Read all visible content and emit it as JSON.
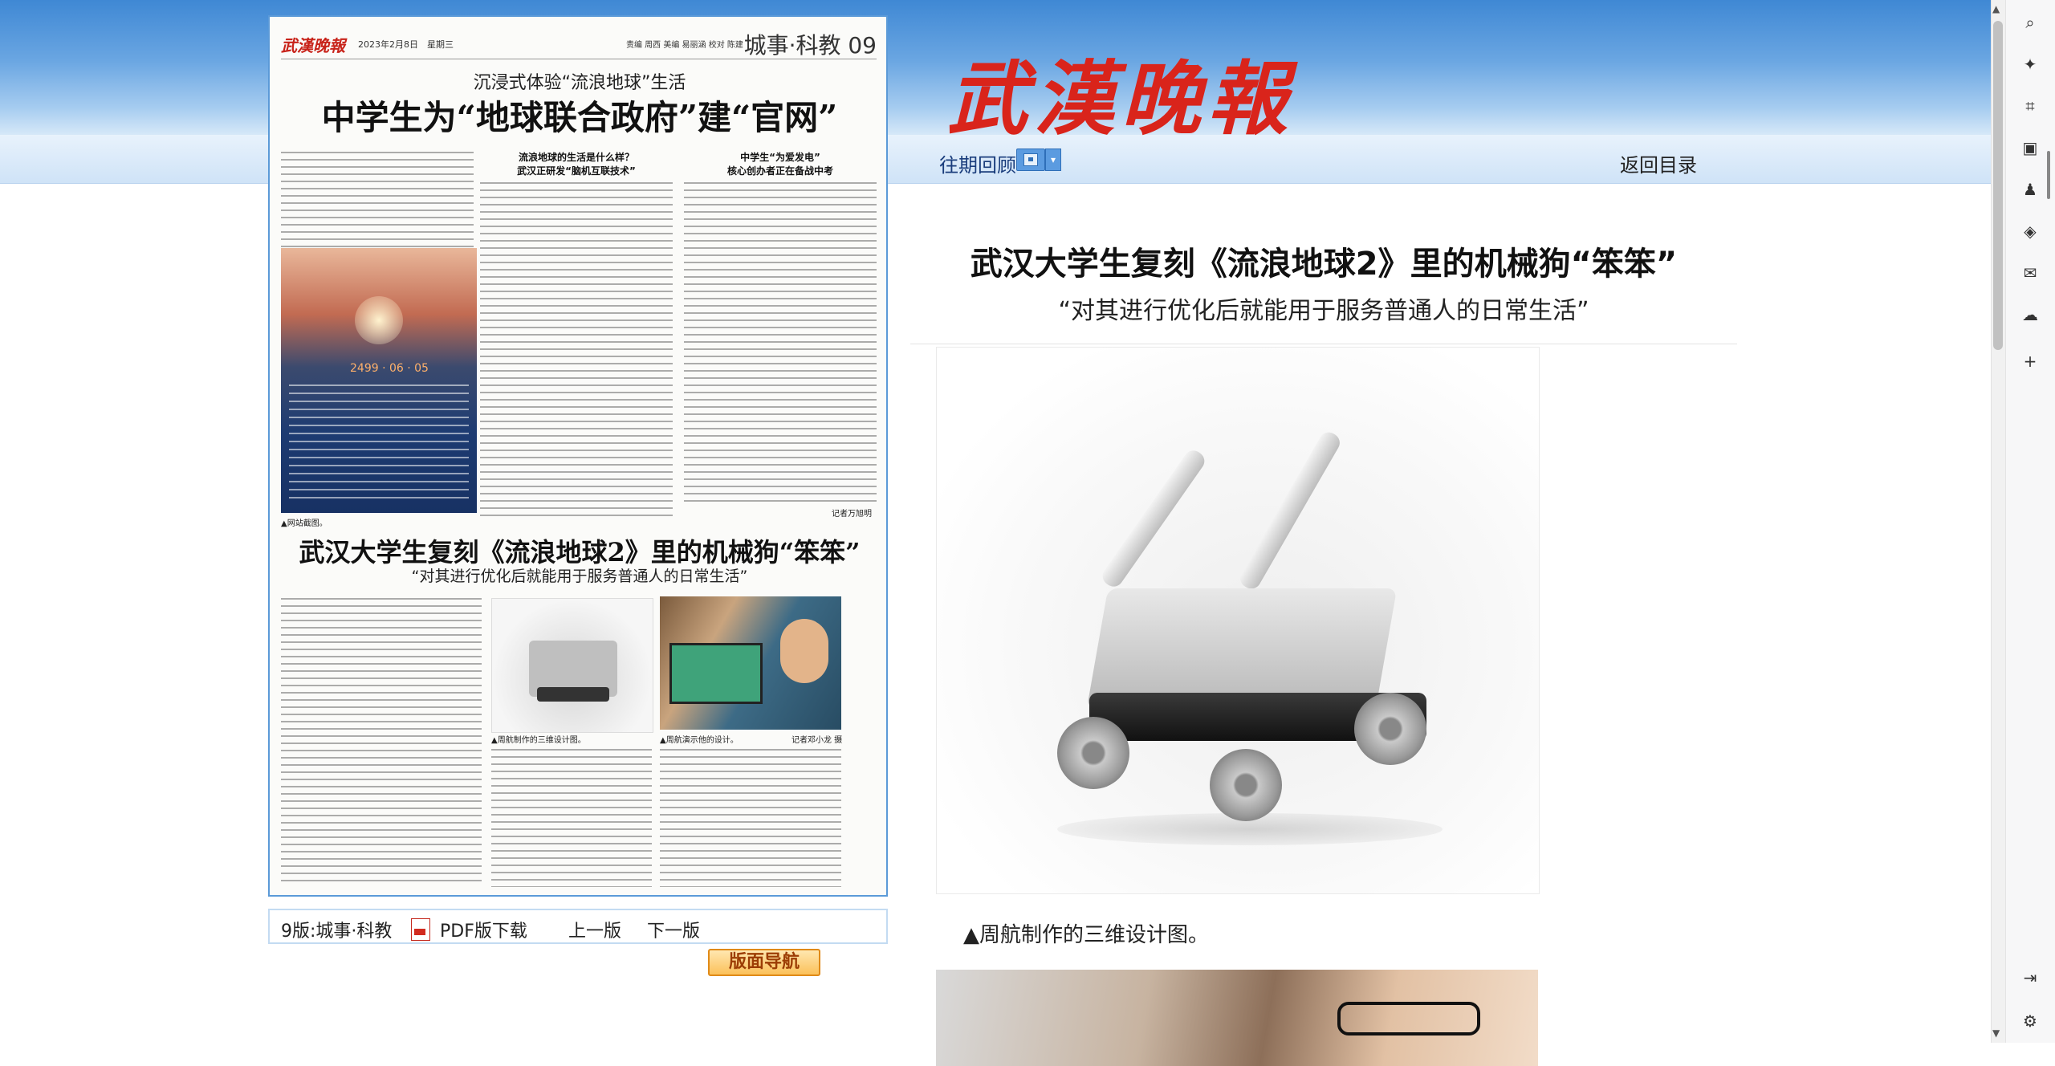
{
  "site": {
    "masthead": "武漢晚報",
    "nav": {
      "past_issues": "往期回顾",
      "back_to_index": "返回目录",
      "calendar_icon": "calendar-icon",
      "dropdown_icon": "chevron-down-icon"
    }
  },
  "page": {
    "logo": "武漢晚報",
    "date": "2023年2月8日　星期三",
    "editors": "责编 周西  美编 易丽涵  校对 陈建",
    "section": "城事·科教 09",
    "story1": {
      "subtitle": "沉浸式体验“流浪地球”生活",
      "headline": "中学生为“地球联合政府”建“官网”",
      "col2_head": "流浪地球的生活是什么样？\n武汉正研发“脑机互联技术”",
      "col3_head": "中学生“为爱发电”\n核心创办者正在备战中考",
      "cover_date": "2499 · 06 · 05",
      "caption": "▲网站截图。",
      "byline": "记者万旭明"
    },
    "story2": {
      "headline": "武汉大学生复刻《流浪地球2》里的机械狗“笨笨”",
      "subtitle": "“对其进行优化后就能用于服务普通人的日常生活”",
      "caption_design": "▲周航制作的三维设计图。",
      "caption_demo": "▲周航演示他的设计。",
      "photo_credit": "记者邓小龙 摄"
    }
  },
  "page_nav": {
    "current": "9版:城事·科教",
    "pdf": "PDF版下载",
    "prev": "上一版",
    "next": "下一版",
    "layout_nav": "版面导航",
    "pdf_icon": "pdf-icon"
  },
  "article": {
    "title": "武汉大学生复刻《流浪地球2》里的机械狗“笨笨”",
    "subtitle": "“对其进行优化后就能用于服务普通人的日常生活”",
    "caption1": "▲周航制作的三维设计图。"
  },
  "toolbar": {
    "icons": [
      "search-icon",
      "sparkle-icon",
      "tag-icon",
      "briefcase-icon",
      "chess-piece-icon",
      "shapes-icon",
      "outlook-icon",
      "cloud-icon",
      "add-icon",
      "sidebar-icon",
      "settings-icon"
    ],
    "glyphs": [
      "⌕",
      "✦",
      "⌗",
      "▣",
      "♟",
      "◈",
      "✉",
      "☁",
      "+",
      "⇥",
      "⚙"
    ]
  }
}
